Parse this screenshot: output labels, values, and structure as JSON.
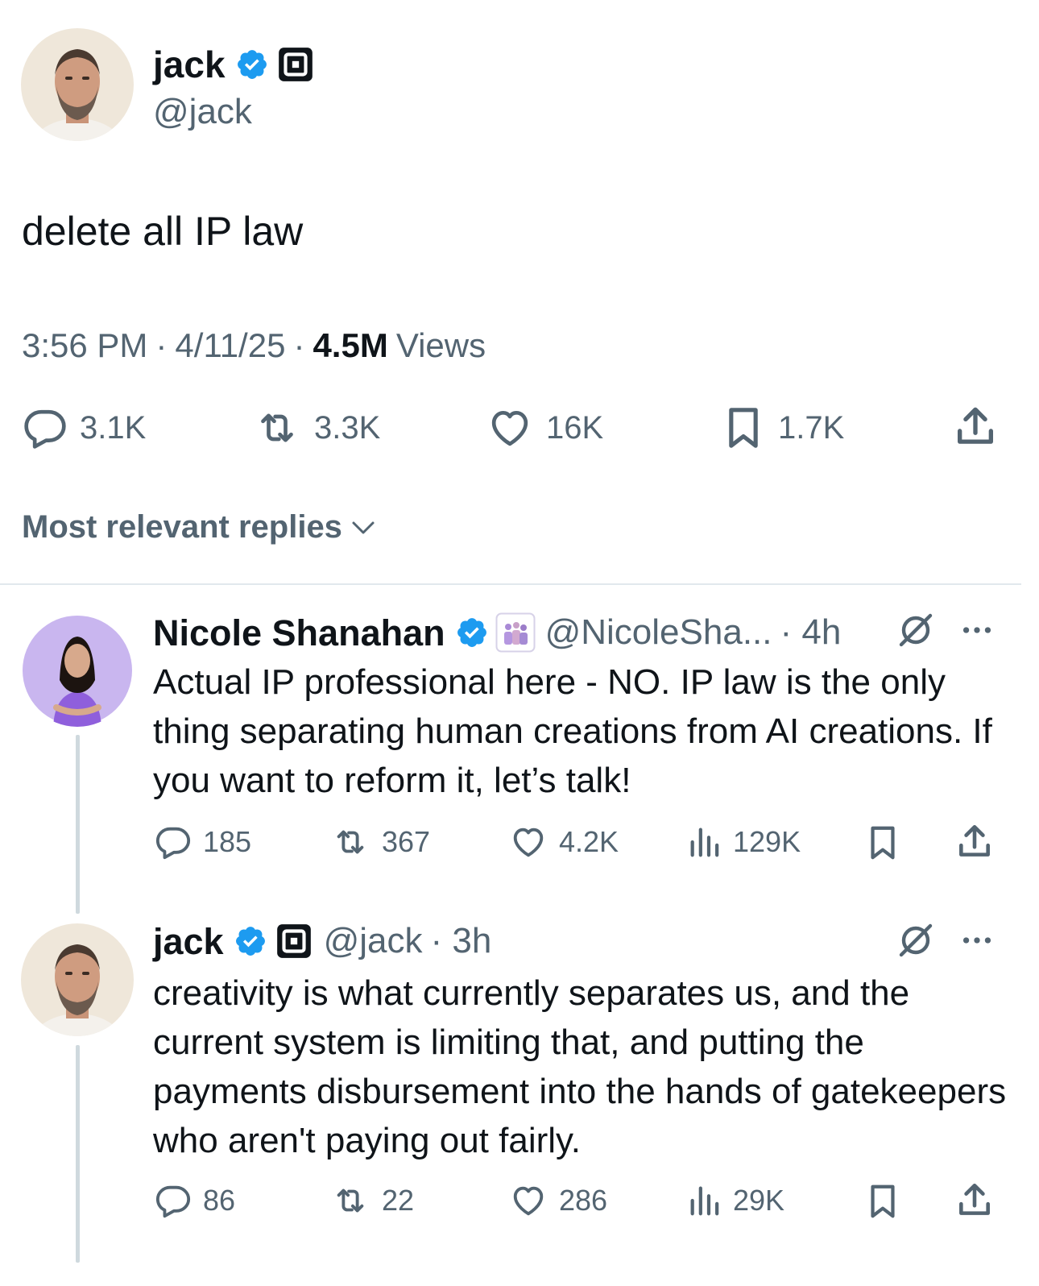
{
  "main_tweet": {
    "author_name": "jack",
    "author_handle": "@jack",
    "text": "delete all IP law",
    "time": "3:56 PM",
    "date": "4/11/25",
    "views_count": "4.5M",
    "views_label": "Views",
    "separator": "·",
    "stats": {
      "replies": "3.1K",
      "reposts": "3.3K",
      "likes": "16K",
      "bookmarks": "1.7K"
    }
  },
  "replies_sort": {
    "label": "Most relevant replies"
  },
  "replies": [
    {
      "author_name": "Nicole Shanahan",
      "author_handle": "@NicoleSha...",
      "time": "· 4h",
      "text": "Actual IP professional here - NO. IP law is the only thing separating human creations from AI creations. If you want to reform it, let’s talk!",
      "stats": {
        "replies": "185",
        "reposts": "367",
        "likes": "4.2K",
        "views": "129K"
      }
    },
    {
      "author_name": "jack",
      "author_handle": "@jack",
      "time": "· 3h",
      "text": "creativity is what currently separates us, and the current system is limiting that, and putting the payments disbursement into the hands of gatekeepers who aren't paying out fairly.",
      "stats": {
        "replies": "86",
        "reposts": "22",
        "likes": "286",
        "views": "29K"
      }
    }
  ],
  "colors": {
    "verified_blue": "#1d9bf0",
    "text_gray": "#536471",
    "text_dark": "#0f1419",
    "divider": "#e1e8ed"
  },
  "icons": [
    "verified-badge-icon",
    "square-logo-icon",
    "reply-icon",
    "repost-icon",
    "like-icon",
    "bookmark-icon",
    "share-icon",
    "views-icon",
    "grok-icon",
    "more-icon",
    "chevron-down-icon"
  ]
}
